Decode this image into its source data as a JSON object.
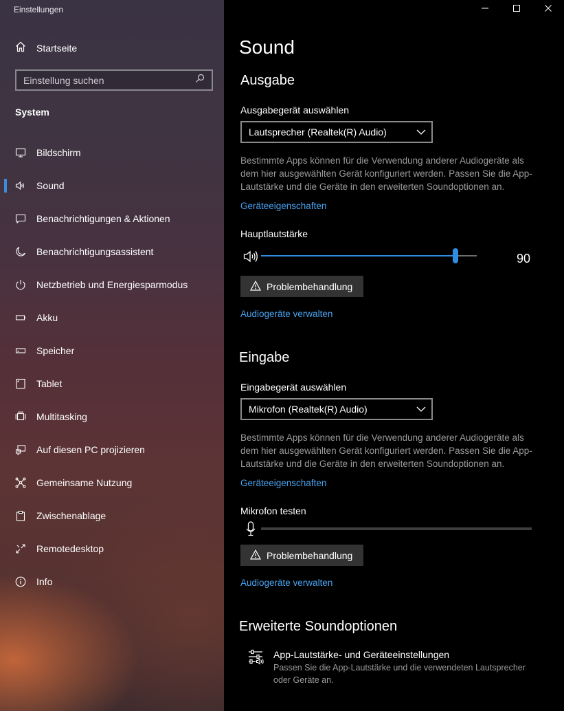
{
  "window": {
    "title": "Einstellungen"
  },
  "sidebar": {
    "home_label": "Startseite",
    "search_placeholder": "Einstellung suchen",
    "section_heading": "System",
    "items": [
      {
        "label": "Bildschirm",
        "icon": "monitor-icon"
      },
      {
        "label": "Sound",
        "icon": "speaker-icon",
        "active": true
      },
      {
        "label": "Benachrichtigungen & Aktionen",
        "icon": "notification-icon"
      },
      {
        "label": "Benachrichtigungsassistent",
        "icon": "moon-icon"
      },
      {
        "label": "Netzbetrieb und Energiesparmodus",
        "icon": "power-icon"
      },
      {
        "label": "Akku",
        "icon": "battery-icon"
      },
      {
        "label": "Speicher",
        "icon": "storage-icon"
      },
      {
        "label": "Tablet",
        "icon": "tablet-icon"
      },
      {
        "label": "Multitasking",
        "icon": "multitasking-icon"
      },
      {
        "label": "Auf diesen PC projizieren",
        "icon": "project-icon"
      },
      {
        "label": "Gemeinsame Nutzung",
        "icon": "share-icon"
      },
      {
        "label": "Zwischenablage",
        "icon": "clipboard-icon"
      },
      {
        "label": "Remotedesktop",
        "icon": "remote-icon"
      },
      {
        "label": "Info",
        "icon": "info-icon"
      }
    ]
  },
  "main": {
    "title": "Sound",
    "output": {
      "heading": "Ausgabe",
      "device_label": "Ausgabegerät auswählen",
      "device_value": "Lautsprecher (Realtek(R) Audio)",
      "description": "Bestimmte Apps können für die Verwendung anderer Audiogeräte als dem hier ausgewählten Gerät konfiguriert werden. Passen Sie die App-Lautstärke und die Geräte in den erweiterten Soundoptionen an.",
      "properties_link": "Geräteeigenschaften",
      "volume_label": "Hauptlautstärke",
      "volume_value": "90",
      "volume_level": 90,
      "troubleshoot_label": "Problembehandlung",
      "manage_link": "Audiogeräte verwalten"
    },
    "input": {
      "heading": "Eingabe",
      "device_label": "Eingabegerät auswählen",
      "device_value": "Mikrofon (Realtek(R) Audio)",
      "description": "Bestimmte Apps können für die Verwendung anderer Audiogeräte als dem hier ausgewählten Gerät konfiguriert werden. Passen Sie die App-Lautstärke und die Geräte in den erweiterten Soundoptionen an.",
      "properties_link": "Geräteeigenschaften",
      "test_label": "Mikrofon testen",
      "troubleshoot_label": "Problembehandlung",
      "manage_link": "Audiogeräte verwalten"
    },
    "advanced": {
      "heading": "Erweiterte Soundoptionen",
      "item_title": "App-Lautstärke- und Geräteeinstellungen",
      "item_desc": "Passen Sie die App-Lautstärke und die verwendeten Lautsprecher oder Geräte an."
    }
  },
  "colors": {
    "accent": "#2e8ee2",
    "link": "#4aa3f0"
  }
}
